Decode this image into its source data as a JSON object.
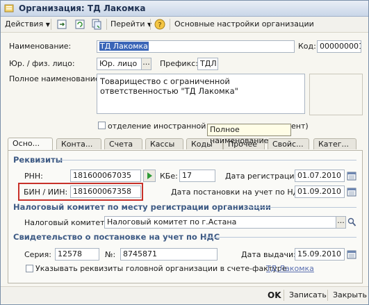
{
  "window": {
    "title": "Организация: ТД Лакомка"
  },
  "toolbar": {
    "actions_label": "Действия",
    "goto_label": "Перейти",
    "help_icon": "question-icon",
    "main_settings_label": "Основные настройки организации"
  },
  "header": {
    "name_label": "Наименование:",
    "name_value": "ТД Лакомка",
    "code_label": "Код:",
    "code_value": "000000001",
    "entity_type_label": "Юр. / физ. лицо:",
    "entity_type_value": "Юр. лицо",
    "prefix_label": "Префикс:",
    "prefix_value": "ТДЛ",
    "full_name_label": "Полное наименование:",
    "full_name_value": "Товарищество с ограниченной ответственностью \"ТД Лакомка\"",
    "foreign_branch_label_a": "отделение иностранной орга",
    "foreign_branch_label_b": "ент)"
  },
  "tooltip": {
    "text": "Полное наименование"
  },
  "tabs": [
    {
      "label": "Осно...",
      "active": true
    },
    {
      "label": "Конта...",
      "active": false
    },
    {
      "label": "Счета",
      "active": false
    },
    {
      "label": "Кассы",
      "active": false
    },
    {
      "label": "Коды",
      "active": false
    },
    {
      "label": "Прочее",
      "active": false
    },
    {
      "label": "Свойс...",
      "active": false
    },
    {
      "label": "Катег...",
      "active": false
    }
  ],
  "requisites": {
    "header": "Реквизиты",
    "rnn_label": "РНН:",
    "rnn_value": "181600067035",
    "kbe_label": "КБе:",
    "kbe_value": "17",
    "reg_date_label": "Дата регистрации:",
    "reg_date_value": "01.07.2010",
    "bin_label": "БИН / ИИН:",
    "bin_value": "181600067358",
    "vat_date_label": "Дата постановки на учет по НДС:",
    "vat_date_value": "01.09.2010"
  },
  "tax_committee": {
    "header": "Налоговый комитет по месту регистрации организации",
    "label": "Налоговый комитет:",
    "value": "Налоговый комитет по г.Астана"
  },
  "vat_certificate": {
    "header": "Свидетельство о постановке на учет по НДС",
    "series_label": "Серия:",
    "series_value": "12578",
    "number_label": "№:",
    "number_value": "8745871",
    "issue_date_label": "Дата выдачи:",
    "issue_date_value": "15.09.2010",
    "head_org_label": "Указывать реквизиты головной организации в счете-фактуре",
    "head_org_link": "ТД Лакомка"
  },
  "footer": {
    "ok_label": "OK",
    "save_label": "Записать",
    "close_label": "Закрыть"
  },
  "colors": {
    "accent": "#3d5a84",
    "highlight": "#c8312a",
    "link": "#5a6fb0"
  }
}
